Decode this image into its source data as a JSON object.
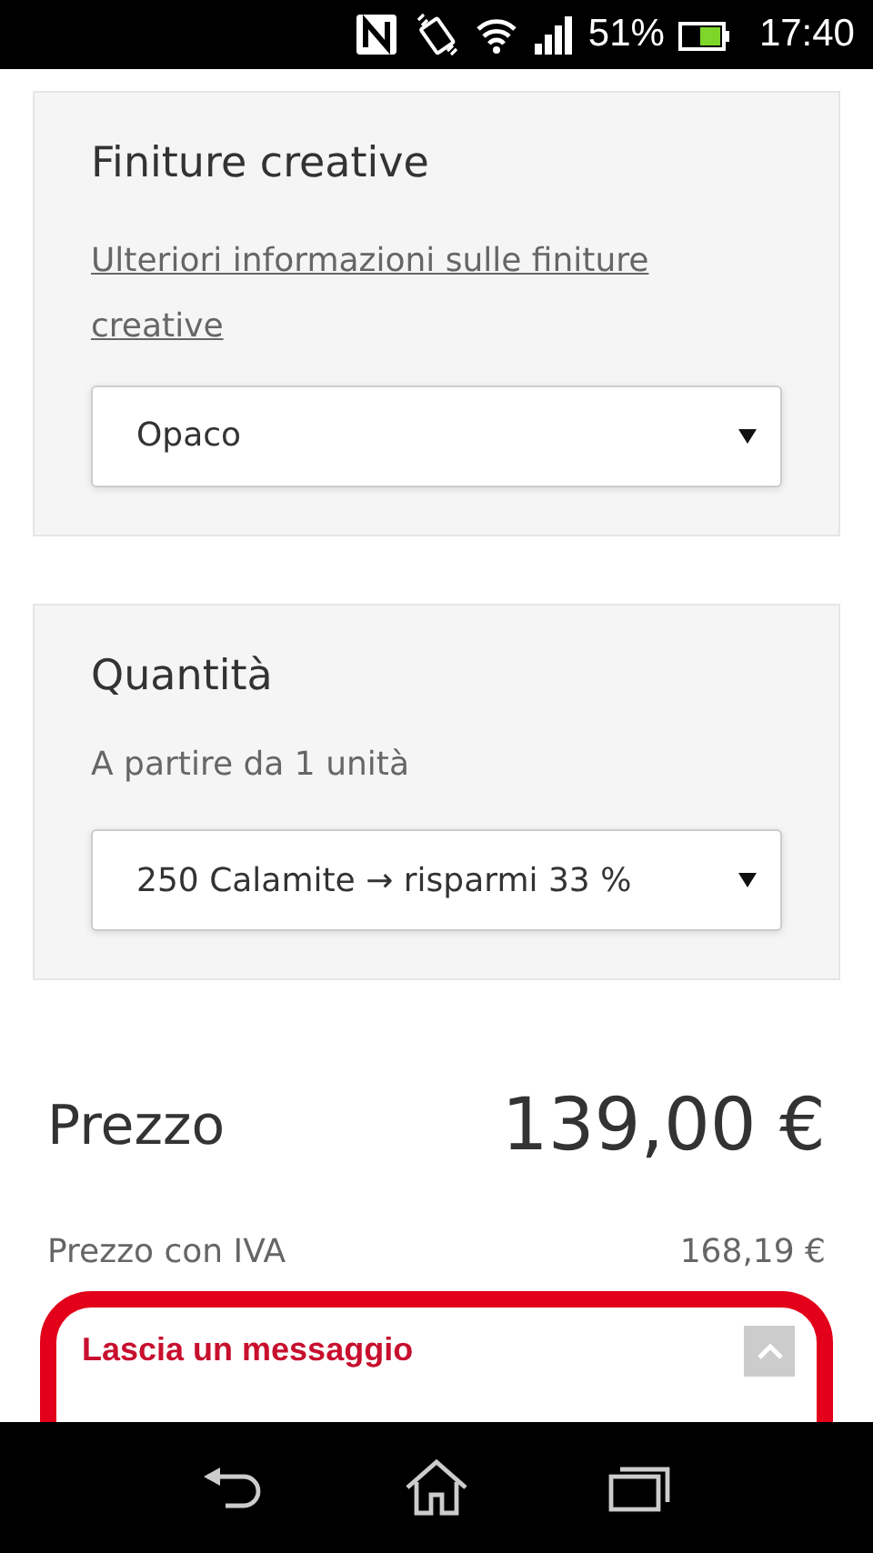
{
  "status_bar": {
    "battery_text": "51%",
    "time": "17:40"
  },
  "finish_panel": {
    "title": "Finiture creative",
    "link": "Ulteriori informazioni sulle finiture creative",
    "select_value": "Opaco"
  },
  "quantity_panel": {
    "title": "Quantità",
    "hint": "A partire da 1 unità",
    "select_value": "250 Calamite → risparmi 33 %"
  },
  "price": {
    "label": "Prezzo",
    "value": "139,00 €",
    "vat_label": "Prezzo con IVA",
    "vat_value": "168,19 €"
  },
  "chat_widget": {
    "title": "Lascia un messaggio",
    "expanded": false
  }
}
